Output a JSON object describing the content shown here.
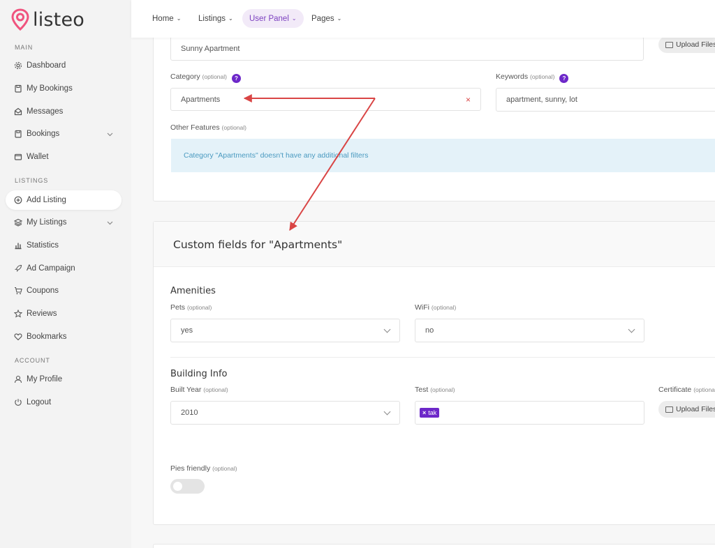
{
  "brand": {
    "name": "listeo",
    "color": "#f0537e"
  },
  "sidebar": {
    "main_label": "MAIN",
    "listings_label": "LISTINGS",
    "account_label": "ACCOUNT",
    "items": [
      {
        "label": "Dashboard",
        "icon": "gear-icon"
      },
      {
        "label": "My Bookings",
        "icon": "file-icon"
      },
      {
        "label": "Messages",
        "icon": "envelope-icon"
      },
      {
        "label": "Bookings",
        "icon": "file-icon"
      },
      {
        "label": "Wallet",
        "icon": "wallet-icon"
      },
      {
        "label": "Add Listing",
        "icon": "plus-circle-icon"
      },
      {
        "label": "My Listings",
        "icon": "layers-icon"
      },
      {
        "label": "Statistics",
        "icon": "bar-chart-icon"
      },
      {
        "label": "Ad Campaign",
        "icon": "rocket-icon"
      },
      {
        "label": "Coupons",
        "icon": "cart-icon"
      },
      {
        "label": "Reviews",
        "icon": "star-icon"
      },
      {
        "label": "Bookmarks",
        "icon": "heart-icon"
      },
      {
        "label": "My Profile",
        "icon": "user-icon"
      },
      {
        "label": "Logout",
        "icon": "power-icon"
      }
    ]
  },
  "topnav": {
    "items": [
      "Home",
      "Listings",
      "User Panel",
      "Pages"
    ],
    "active": "User Panel"
  },
  "form": {
    "title_value": "Sunny Apartment",
    "upload_label": "Upload Files",
    "category_label": "Category",
    "optional": "(optional)",
    "help": "?",
    "category_value": "Apartments",
    "clear": "×",
    "keywords_label": "Keywords",
    "keywords_value": "apartment, sunny, lot",
    "other_features_label": "Other Features",
    "info_text": "Category \"Apartments\" doesn't have any additional filters"
  },
  "custom": {
    "title": "Custom fields for \"Apartments\"",
    "amenities": "Amenities",
    "pets_label": "Pets",
    "pets_value": "yes",
    "wifi_label": "WiFi",
    "wifi_value": "no",
    "building": "Building Info",
    "year_label": "Built Year",
    "year_value": "2010",
    "test_label": "Test",
    "tag": "tak",
    "tag_x": "×",
    "certificate_label": "Certificate",
    "certificate_upload": "Upload Files",
    "pies_label": "Pies friendly"
  },
  "accent": "#6d28c9",
  "annotation_color": "#d94545"
}
